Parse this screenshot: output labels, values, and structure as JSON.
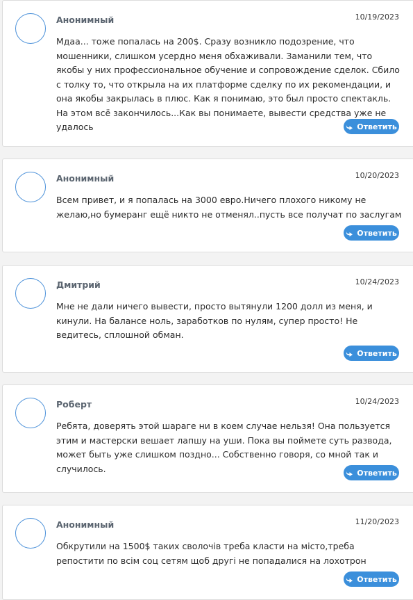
{
  "colors": {
    "accent": "#3b8fdb",
    "avatar_border": "#4a90d9",
    "author": "#5b6570",
    "background": "#f3f3f3"
  },
  "comments": [
    {
      "author": "Анонимный",
      "date": "10/19/2023",
      "text": "Мдаа... тоже попалась на 200$. Сразу возникло подозрение, что мошенники, слишком усердно меня обхаживали. Заманили тем, что якобы у них профессиональное обучение и сопровождение сделок. Сбило с толку то, что открыла на их платформе сделку по их рекомендации, и она якобы закрылась в плюс. Как я понимаю, это был просто спектакль. На этом всё закончилось...Как вы понимаете, вывести средства уже не удалось",
      "reply_label": "Ответить",
      "reply_icon": "reply-arrow-icon"
    },
    {
      "author": "Анонимный",
      "date": "10/20/2023",
      "text": "Всем привет, и я попалась на 3000 евро.Ничего плохого никому не желаю,но бумеранг ещё никто не отменял..пусть все получат по заслугам",
      "reply_label": "Ответить",
      "reply_icon": "reply-arrow-icon"
    },
    {
      "author": "Дмитрий",
      "date": "10/24/2023",
      "text": "Мне не дали ничего вывести, просто вытянули 1200 долл из меня, и кинули. На балансе ноль, заработков по нулям, супер просто! Не ведитесь, сплошной обман.",
      "reply_label": "Ответить",
      "reply_icon": "reply-arrow-icon"
    },
    {
      "author": "Роберт",
      "date": "10/24/2023",
      "text": "Ребята, доверять этой шараге ни в коем случае нельзя! Она пользуется этим и мастерски вешает лапшу на уши. Пока вы поймете суть развода, может быть уже слишком поздно... Собственно говоря, со мной так и случилось.",
      "reply_label": "Ответить",
      "reply_icon": "reply-arrow-icon"
    },
    {
      "author": "Анонимный",
      "date": "11/20/2023",
      "text": "Обкрутили на 1500$ таких сволочів треба класти на місто,треба репостити по всім соц сетям щоб другі не попадалися на лохотрон",
      "reply_label": "Ответить",
      "reply_icon": "reply-arrow-icon"
    }
  ]
}
